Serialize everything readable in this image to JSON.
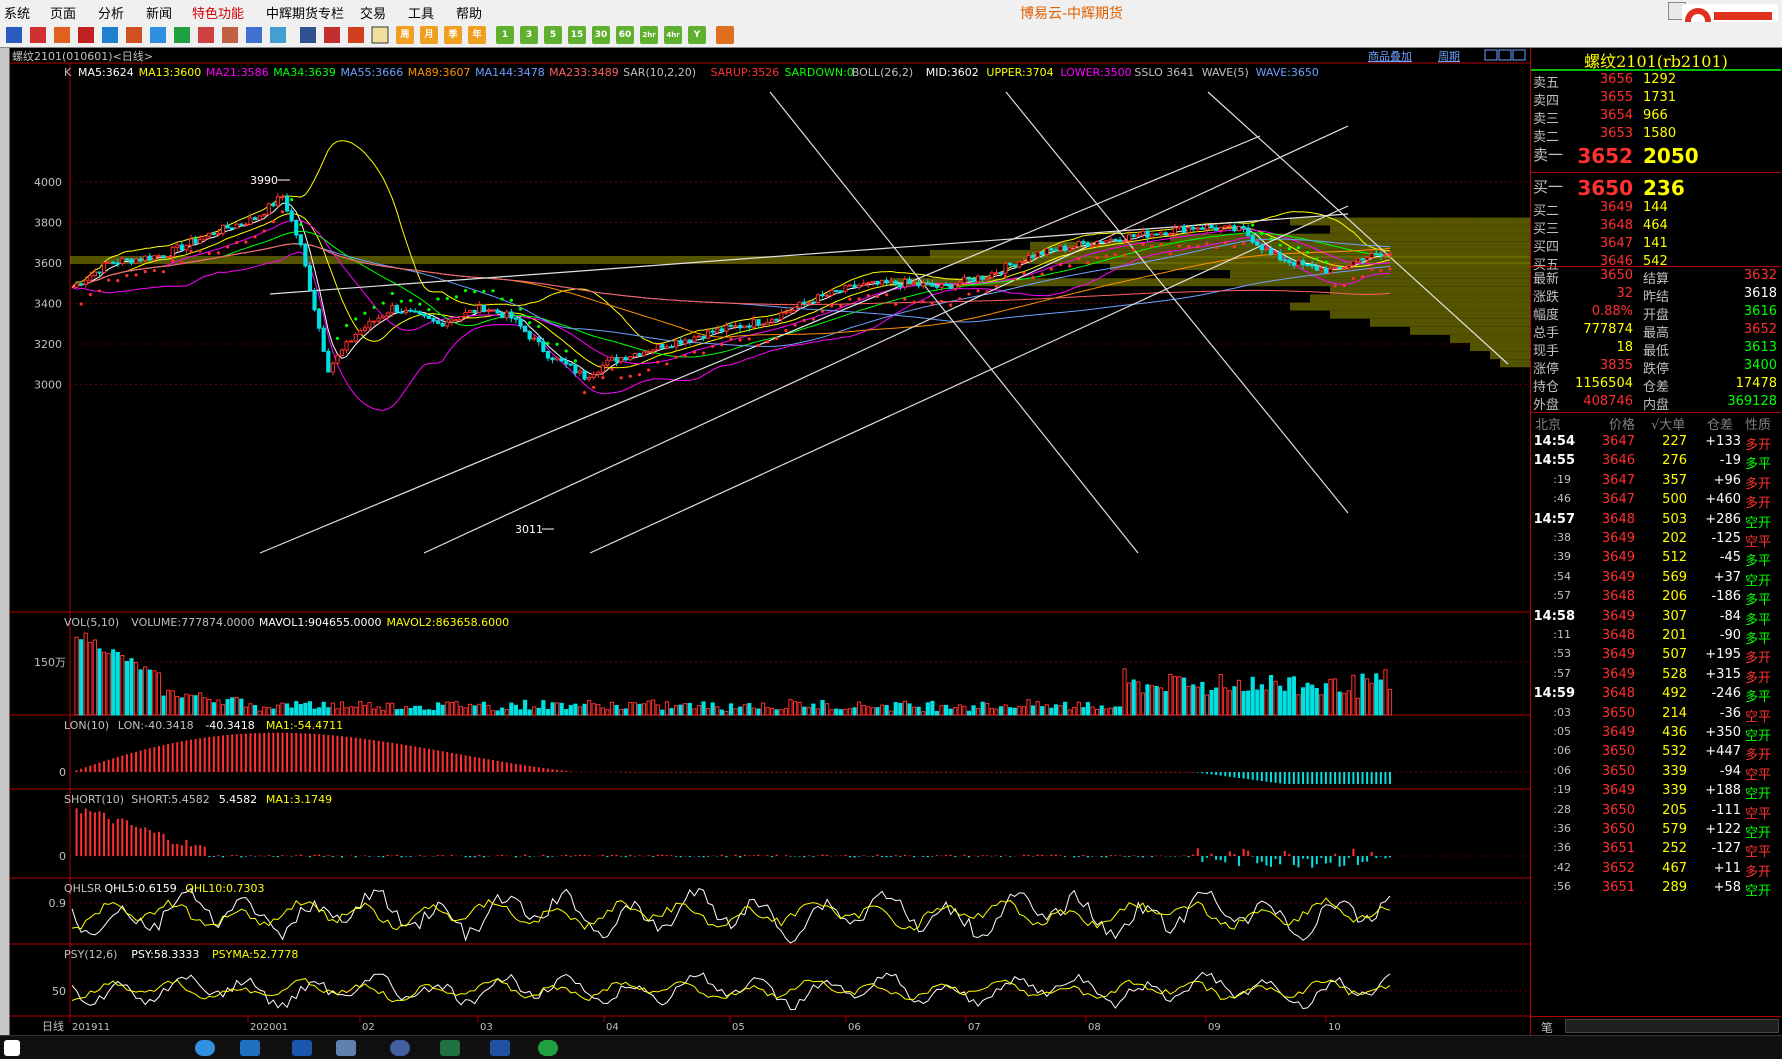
{
  "menu": {
    "items": [
      "系统",
      "页面",
      "分析",
      "新闻",
      "特色功能",
      "中辉期货专栏",
      "交易",
      "工具",
      "帮助"
    ],
    "app_title": "博易云-中辉期货"
  },
  "toolbar": {
    "period_buttons": [
      "周",
      "月",
      "季",
      "年",
      "1",
      "3",
      "5",
      "15",
      "30",
      "60",
      "2hr",
      "4hr",
      "Y"
    ]
  },
  "chart_header": {
    "symbol": "螺纹2101(010601)<日线>",
    "link1": "商品叠加",
    "link2": "周期"
  },
  "main_indicator": {
    "label": "K",
    "items": [
      {
        "t": "MA5:3624",
        "c": "#ffffff"
      },
      {
        "t": "MA13:3600",
        "c": "#ffff00"
      },
      {
        "t": "MA21:3586",
        "c": "#ff00ff"
      },
      {
        "t": "MA34:3639",
        "c": "#00ff00"
      },
      {
        "t": "MA55:3666",
        "c": "#6ea0ff"
      },
      {
        "t": "MA89:3607",
        "c": "#ff9000"
      },
      {
        "t": "MA144:3478",
        "c": "#6ea0ff"
      },
      {
        "t": "MA233:3489",
        "c": "#ff6060"
      },
      {
        "t": "SAR(10,2,20)",
        "c": "#c0c0c0"
      },
      {
        "t": "SARUP:3526",
        "c": "#ff3030"
      },
      {
        "t": "SARDOWN:0",
        "c": "#00ff00"
      },
      {
        "t": "BOLL(26,2)",
        "c": "#c0c0c0"
      },
      {
        "t": "MID:3602",
        "c": "#ffffff"
      },
      {
        "t": "UPPER:3704",
        "c": "#ffff00"
      },
      {
        "t": "LOWER:3500",
        "c": "#ff00ff"
      },
      {
        "t": "SSLO 3641",
        "c": "#c0c0c0"
      },
      {
        "t": "WAVE(5)",
        "c": "#c0c0c0"
      },
      {
        "t": "WAVE:3650",
        "c": "#6ea0ff"
      }
    ]
  },
  "price_axis": {
    "labels": [
      "4000",
      "3800",
      "3600",
      "3400",
      "3200",
      "3000"
    ],
    "high_mark": "3990",
    "low_mark": "3011"
  },
  "volume_panel": {
    "items": [
      {
        "t": "VOL(5,10)",
        "c": "#c0c0c0"
      },
      {
        "t": "VOLUME:777874.0000",
        "c": "#c0c0c0"
      },
      {
        "t": "MAVOL1:904655.0000",
        "c": "#ffffff"
      },
      {
        "t": "MAVOL2:863658.6000",
        "c": "#ffff00"
      }
    ],
    "axis": "150万"
  },
  "lon_panel": {
    "items": [
      {
        "t": "LON(10)",
        "c": "#c0c0c0"
      },
      {
        "t": "LON:-40.3418",
        "c": "#c0c0c0"
      },
      {
        "t": "-40.3418",
        "c": "#ffffff"
      },
      {
        "t": "MA1:-54.4711",
        "c": "#ffff00"
      }
    ],
    "axis": "0"
  },
  "short_panel": {
    "items": [
      {
        "t": "SHORT(10)",
        "c": "#c0c0c0"
      },
      {
        "t": "SHORT:5.4582",
        "c": "#c0c0c0"
      },
      {
        "t": "5.4582",
        "c": "#ffffff"
      },
      {
        "t": "MA1:3.1749",
        "c": "#ffff00"
      }
    ],
    "axis": "0"
  },
  "qhlsr_panel": {
    "items": [
      {
        "t": "QHLSR",
        "c": "#c0c0c0"
      },
      {
        "t": "QHL5:0.6159",
        "c": "#ffffff"
      },
      {
        "t": "QHL10:0.7303",
        "c": "#ffff00"
      }
    ],
    "axis": "0.9"
  },
  "psy_panel": {
    "items": [
      {
        "t": "PSY(12,6)",
        "c": "#c0c0c0"
      },
      {
        "t": "PSY:58.3333",
        "c": "#ffffff"
      },
      {
        "t": "PSYMA:52.7778",
        "c": "#ffff00"
      }
    ],
    "axis": "50"
  },
  "date_axis": {
    "label": "日线",
    "ticks": [
      "201911",
      "202001",
      "02",
      "03",
      "04",
      "05",
      "06",
      "07",
      "08",
      "09",
      "10"
    ]
  },
  "quote": {
    "title": "螺纹2101(rb2101)",
    "asks": [
      {
        "l": "卖五",
        "p": "3656",
        "v": "1292"
      },
      {
        "l": "卖四",
        "p": "3655",
        "v": "1731"
      },
      {
        "l": "卖三",
        "p": "3654",
        "v": "966"
      },
      {
        "l": "卖二",
        "p": "3653",
        "v": "1580"
      },
      {
        "l": "卖一",
        "p": "3652",
        "v": "2050"
      }
    ],
    "bids": [
      {
        "l": "买一",
        "p": "3650",
        "v": "236"
      },
      {
        "l": "买二",
        "p": "3649",
        "v": "144"
      },
      {
        "l": "买三",
        "p": "3648",
        "v": "464"
      },
      {
        "l": "买四",
        "p": "3647",
        "v": "141"
      },
      {
        "l": "买五",
        "p": "3646",
        "v": "542"
      }
    ],
    "stats": [
      {
        "l1": "最新",
        "v1": "3650",
        "c1": "#ff3030",
        "l2": "结算",
        "v2": "3632",
        "c2": "#ff3030"
      },
      {
        "l1": "涨跌",
        "v1": "32",
        "c1": "#ff3030",
        "l2": "昨结",
        "v2": "3618",
        "c2": "#ffffff"
      },
      {
        "l1": "幅度",
        "v1": "0.88%",
        "c1": "#ff3030",
        "l2": "开盘",
        "v2": "3616",
        "c2": "#00ff00"
      },
      {
        "l1": "总手",
        "v1": "777874",
        "c1": "#ffff00",
        "l2": "最高",
        "v2": "3652",
        "c2": "#ff3030"
      },
      {
        "l1": "现手",
        "v1": "18",
        "c1": "#ffff00",
        "l2": "最低",
        "v2": "3613",
        "c2": "#00ff00"
      },
      {
        "l1": "涨停",
        "v1": "3835",
        "c1": "#ff3030",
        "l2": "跌停",
        "v2": "3400",
        "c2": "#00ff00"
      },
      {
        "l1": "持仓",
        "v1": "1156504",
        "c1": "#ffff00",
        "l2": "仓差",
        "v2": "17478",
        "c2": "#ffff00"
      },
      {
        "l1": "外盘",
        "v1": "408746",
        "c1": "#ff3030",
        "l2": "内盘",
        "v2": "369128",
        "c2": "#00ff00"
      }
    ]
  },
  "ticks_header": {
    "c1": "北京",
    "c2": "价格",
    "c3": "√大单",
    "c4": "仓差",
    "c5": "性质"
  },
  "ticks": [
    {
      "t": "14:54",
      "p": "3647",
      "v": "227",
      "d": "+133",
      "n": "多开",
      "nc": "#ff3030",
      "big": true
    },
    {
      "t": "14:55",
      "p": "3646",
      "v": "276",
      "d": "-19",
      "n": "多平",
      "nc": "#00ff00",
      "big": true
    },
    {
      "t": ":19",
      "p": "3647",
      "v": "357",
      "d": "+96",
      "n": "多开",
      "nc": "#ff3030"
    },
    {
      "t": ":46",
      "p": "3647",
      "v": "500",
      "d": "+460",
      "n": "多开",
      "nc": "#ff3030"
    },
    {
      "t": "14:57",
      "p": "3648",
      "v": "503",
      "d": "+286",
      "n": "空开",
      "nc": "#00ff00",
      "big": true
    },
    {
      "t": ":38",
      "p": "3649",
      "v": "202",
      "d": "-125",
      "n": "空平",
      "nc": "#ff3030"
    },
    {
      "t": ":39",
      "p": "3649",
      "v": "512",
      "d": "-45",
      "n": "多平",
      "nc": "#00ff00"
    },
    {
      "t": ":54",
      "p": "3649",
      "v": "569",
      "d": "+37",
      "n": "空开",
      "nc": "#00ff00"
    },
    {
      "t": ":57",
      "p": "3648",
      "v": "206",
      "d": "-186",
      "n": "多平",
      "nc": "#00ff00"
    },
    {
      "t": "14:58",
      "p": "3649",
      "v": "307",
      "d": "-84",
      "n": "多平",
      "nc": "#00ff00",
      "big": true
    },
    {
      "t": ":11",
      "p": "3648",
      "v": "201",
      "d": "-90",
      "n": "多平",
      "nc": "#00ff00"
    },
    {
      "t": ":53",
      "p": "3649",
      "v": "507",
      "d": "+195",
      "n": "多开",
      "nc": "#ff3030"
    },
    {
      "t": ":57",
      "p": "3649",
      "v": "528",
      "d": "+315",
      "n": "多开",
      "nc": "#ff3030"
    },
    {
      "t": "14:59",
      "p": "3648",
      "v": "492",
      "d": "-246",
      "n": "多平",
      "nc": "#00ff00",
      "big": true
    },
    {
      "t": ":03",
      "p": "3650",
      "v": "214",
      "d": "-36",
      "n": "空平",
      "nc": "#ff3030"
    },
    {
      "t": ":05",
      "p": "3649",
      "v": "436",
      "d": "+350",
      "n": "空开",
      "nc": "#00ff00"
    },
    {
      "t": ":06",
      "p": "3650",
      "v": "532",
      "d": "+447",
      "n": "多开",
      "nc": "#ff3030"
    },
    {
      "t": ":06",
      "p": "3650",
      "v": "339",
      "d": "-94",
      "n": "空平",
      "nc": "#ff3030"
    },
    {
      "t": ":19",
      "p": "3649",
      "v": "339",
      "d": "+188",
      "n": "空开",
      "nc": "#00ff00"
    },
    {
      "t": ":28",
      "p": "3650",
      "v": "205",
      "d": "-111",
      "n": "空平",
      "nc": "#ff3030"
    },
    {
      "t": ":36",
      "p": "3650",
      "v": "579",
      "d": "+122",
      "n": "空开",
      "nc": "#00ff00"
    },
    {
      "t": ":36",
      "p": "3651",
      "v": "252",
      "d": "-127",
      "n": "空平",
      "nc": "#ff3030"
    },
    {
      "t": ":42",
      "p": "3652",
      "v": "467",
      "d": "+11",
      "n": "多开",
      "nc": "#ff3030"
    },
    {
      "t": ":56",
      "p": "3651",
      "v": "289",
      "d": "+58",
      "n": "空开",
      "nc": "#00ff00"
    }
  ],
  "side_footer": "笔"
}
